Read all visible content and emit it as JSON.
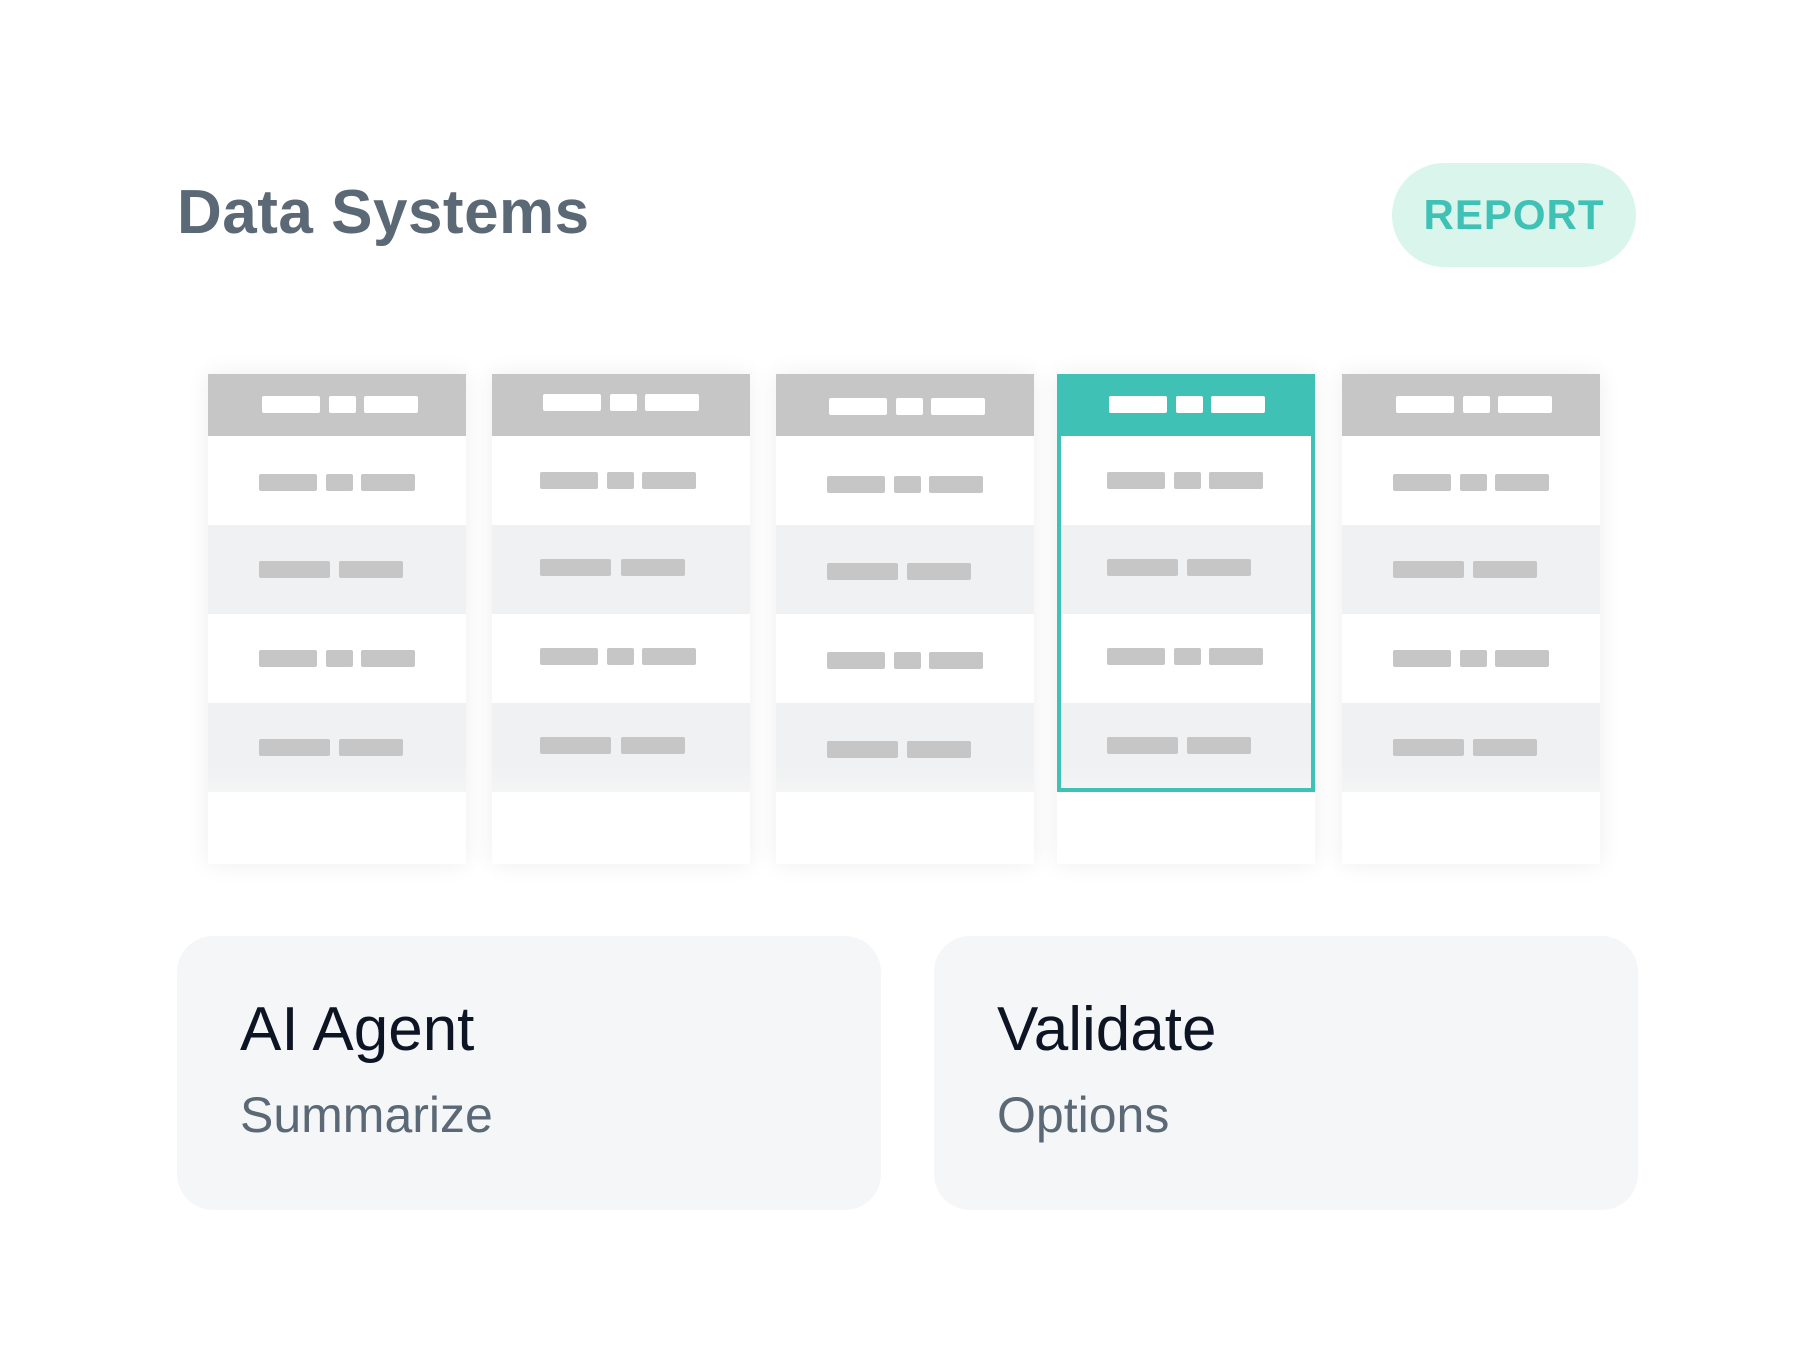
{
  "header": {
    "title": "Data Systems",
    "report_label": "REPORT"
  },
  "table_preview": {
    "columns": 5,
    "rows": 4,
    "selected_column": 4,
    "accent_color": "#40c1b5",
    "placeholder_color": "#c6c6c6"
  },
  "cards": [
    {
      "title": "AI Agent",
      "subtitle": "Summarize"
    },
    {
      "title": "Validate",
      "subtitle": "Options"
    }
  ]
}
